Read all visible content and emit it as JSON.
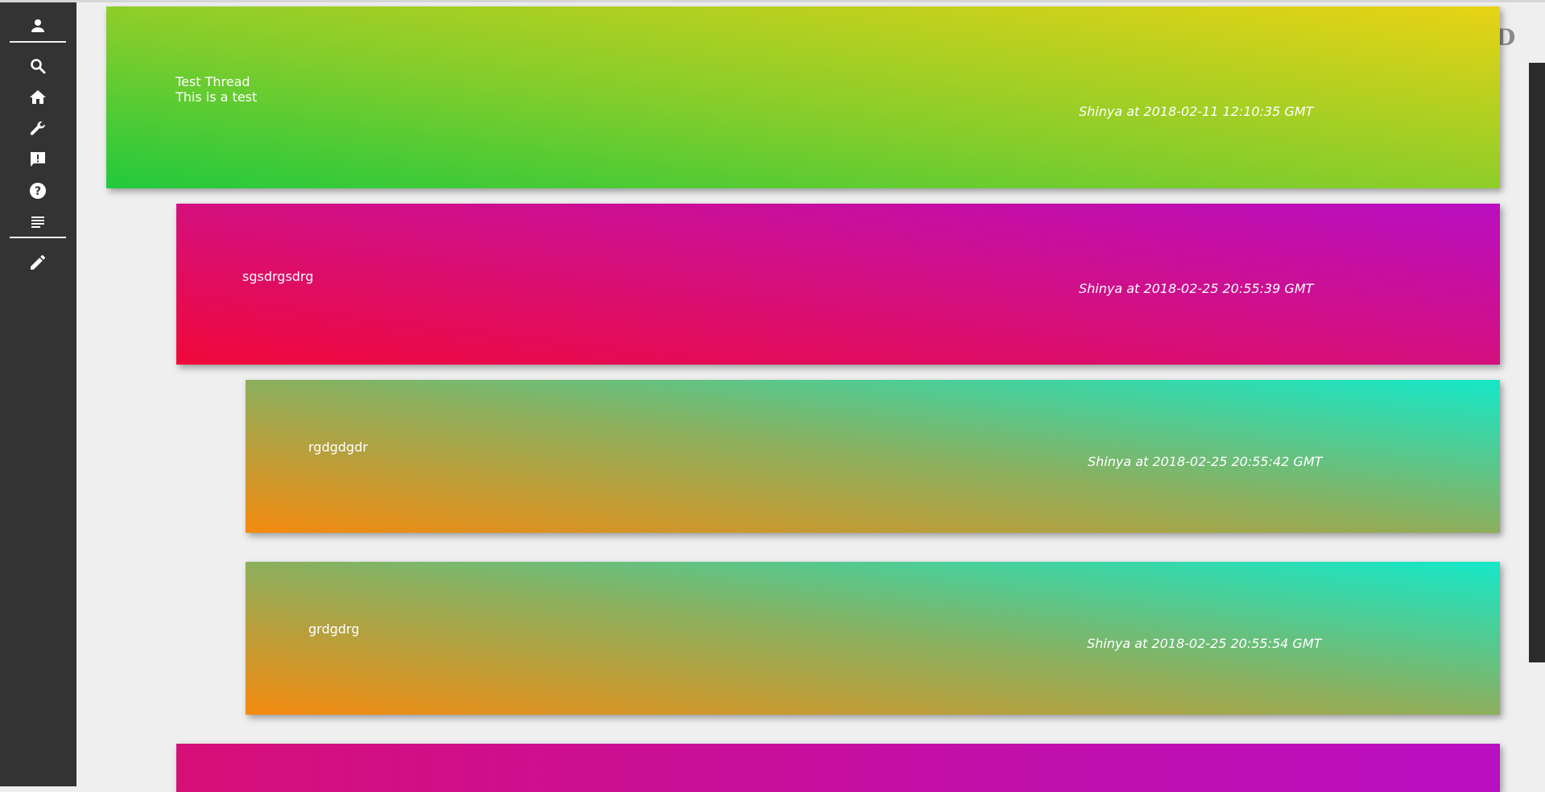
{
  "sidebar": {
    "icons": [
      "person-icon",
      "search-icon",
      "home-icon",
      "wrench-icon",
      "feedback-icon",
      "help-icon",
      "list-icon",
      "pencil-icon"
    ]
  },
  "threads": [
    {
      "title": "Test Thread",
      "body": "This is a test",
      "meta": "Shinya at 2018-02-11 12:10:35 GMT"
    },
    {
      "title": "sgsdrgsdrg",
      "meta": "Shinya at 2018-02-25 20:55:39 GMT"
    },
    {
      "title": "rgdgdgdr",
      "meta": "Shinya at 2018-02-25 20:55:42 GMT"
    },
    {
      "title": "grdgdrg",
      "meta": "Shinya at 2018-02-25 20:55:54 GMT"
    }
  ],
  "colors": {
    "sidebar": "#333333",
    "background": "#efefef",
    "text": "#ffffff"
  }
}
